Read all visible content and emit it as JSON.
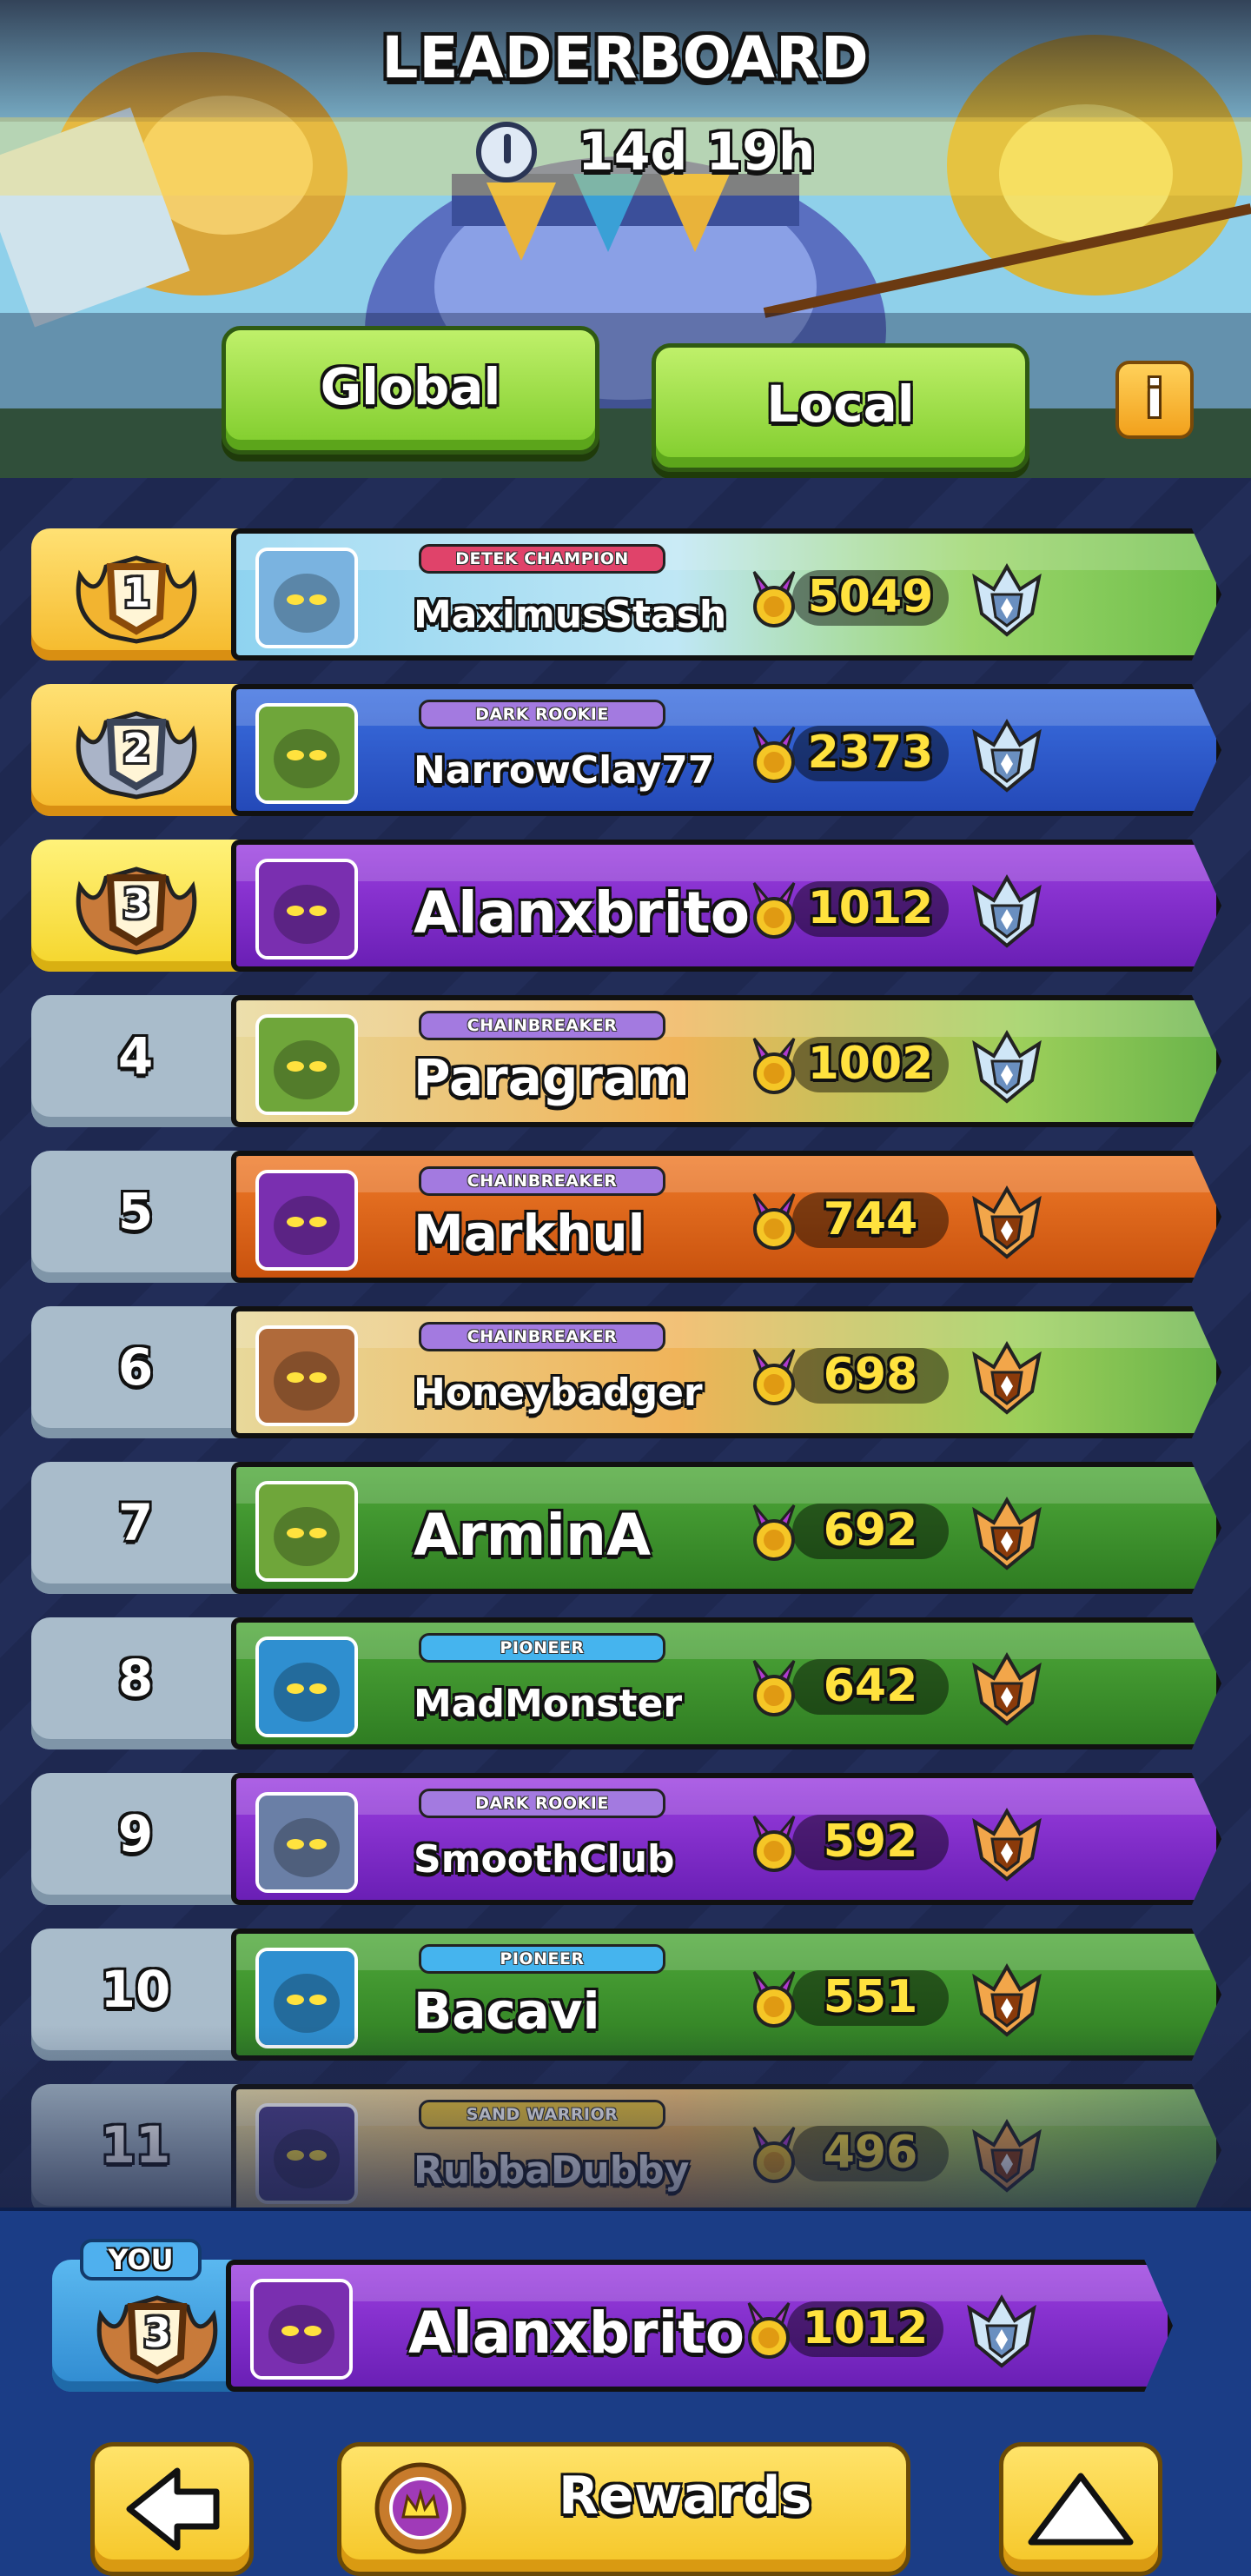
{
  "header": {
    "title": "LEADERBOARD",
    "timer": "14d 19h"
  },
  "tabs": {
    "global": "Global",
    "local": "Local",
    "info": "i"
  },
  "colors": {
    "green_button": "#7fcc2b",
    "yellow_button": "#f5c626",
    "score_yellow": "#ffe23e"
  },
  "rows": [
    {
      "rank": "1",
      "tag": "DETEK CHAMPION",
      "name": "MaximusStash",
      "score": "5049",
      "banner": "landscape-blue",
      "league": "diamond",
      "avatar": "knight"
    },
    {
      "rank": "2",
      "tag": "DARK ROOKIE",
      "name": "NarrowClay77",
      "score": "2373",
      "banner": "blue",
      "league": "diamond",
      "avatar": "goblin-green"
    },
    {
      "rank": "3",
      "tag": "",
      "name": "Alanxbrito",
      "score": "1012",
      "banner": "purple",
      "league": "diamond",
      "avatar": "shadow-purple"
    },
    {
      "rank": "4",
      "tag": "CHAINBREAKER",
      "name": "Paragram",
      "score": "1002",
      "banner": "landscape-orange",
      "league": "diamond",
      "avatar": "goblin-green"
    },
    {
      "rank": "5",
      "tag": "CHAINBREAKER",
      "name": "Markhul",
      "score": "744",
      "banner": "orange",
      "league": "gold",
      "avatar": "shadow-purple"
    },
    {
      "rank": "6",
      "tag": "CHAINBREAKER",
      "name": "Honeybadger",
      "score": "698",
      "banner": "landscape-orange",
      "league": "gold",
      "avatar": "brute"
    },
    {
      "rank": "7",
      "tag": "",
      "name": "ArminA",
      "score": "692",
      "banner": "green",
      "league": "gold",
      "avatar": "goblin-green"
    },
    {
      "rank": "8",
      "tag": "PIONEER",
      "name": "MadMonster",
      "score": "642",
      "banner": "green",
      "league": "gold",
      "avatar": "wizard-blue"
    },
    {
      "rank": "9",
      "tag": "DARK ROOKIE",
      "name": "SmoothClub",
      "score": "592",
      "banner": "purple",
      "league": "gold",
      "avatar": "helmet"
    },
    {
      "rank": "10",
      "tag": "PIONEER",
      "name": "Bacavi",
      "score": "551",
      "banner": "green",
      "league": "gold",
      "avatar": "wizard-blue"
    },
    {
      "rank": "11",
      "tag": "SAND WARRIOR",
      "name": "RubbaDubby",
      "score": "496",
      "banner": "landscape-orange",
      "league": "gold",
      "avatar": "beast"
    }
  ],
  "you": {
    "badge": "YOU",
    "rank": "3",
    "name": "Alanxbrito",
    "score": "1012"
  },
  "bottom_bar": {
    "back_icon": "arrow-left-icon",
    "rewards_label": "Rewards",
    "up_icon": "triangle-up-icon"
  }
}
